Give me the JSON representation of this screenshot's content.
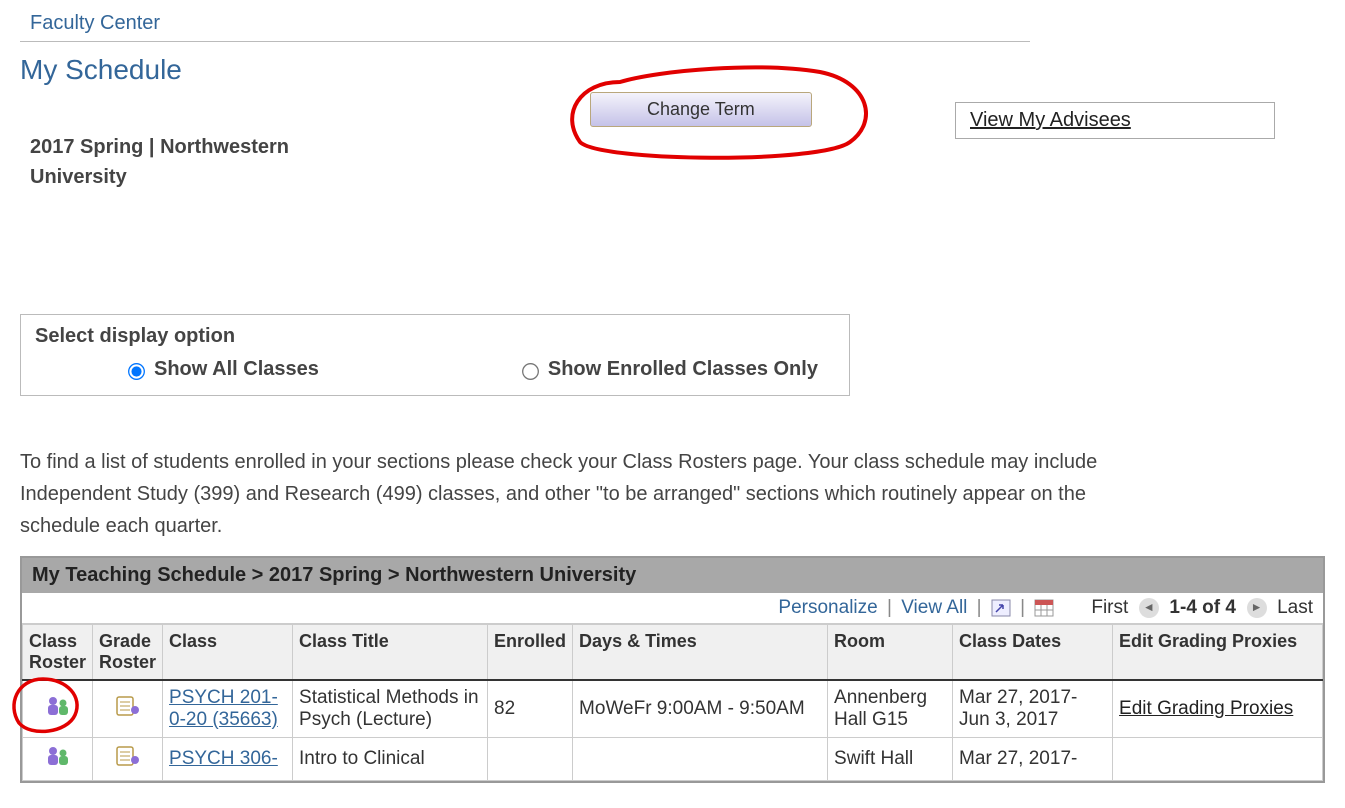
{
  "header": {
    "faculty_center": "Faculty Center",
    "my_schedule": "My Schedule"
  },
  "term": {
    "text": "2017 Spring | Northwestern University",
    "change_btn": "Change Term"
  },
  "advisees_link": "View My Advisees",
  "display_option": {
    "title": "Select display option",
    "opt_all": "Show All Classes",
    "opt_enrolled": "Show Enrolled Classes Only"
  },
  "info_text": "To find a list of students enrolled in your sections please check your Class Rosters page. Your class schedule may include Independent Study (399) and Research (499) classes, and other \"to be arranged\" sections which routinely appear on the schedule each quarter.",
  "schedule": {
    "header": "My Teaching Schedule > 2017 Spring > Northwestern University",
    "toolbar": {
      "personalize": "Personalize",
      "view_all": "View All",
      "first": "First",
      "count": "1-4 of 4",
      "last": "Last"
    },
    "columns": {
      "class_roster": "Class Roster",
      "grade_roster": "Grade Roster",
      "class": "Class",
      "class_title": "Class Title",
      "enrolled": "Enrolled",
      "days_times": "Days & Times",
      "room": "Room",
      "class_dates": "Class Dates",
      "edit_proxies": "Edit Grading Proxies"
    },
    "rows": [
      {
        "class": "PSYCH 201-0-20 (35663)",
        "title": "Statistical Methods in Psych (Lecture)",
        "enrolled": "82",
        "days_times": "MoWeFr 9:00AM - 9:50AM",
        "room": "Annenberg Hall G15",
        "dates": "Mar 27, 2017-Jun 3, 2017",
        "proxies": "Edit Grading Proxies"
      },
      {
        "class": "PSYCH 306-",
        "title": "Intro to Clinical",
        "enrolled": "",
        "days_times": "",
        "room": "Swift Hall",
        "dates": "Mar 27, 2017-",
        "proxies": ""
      }
    ]
  }
}
